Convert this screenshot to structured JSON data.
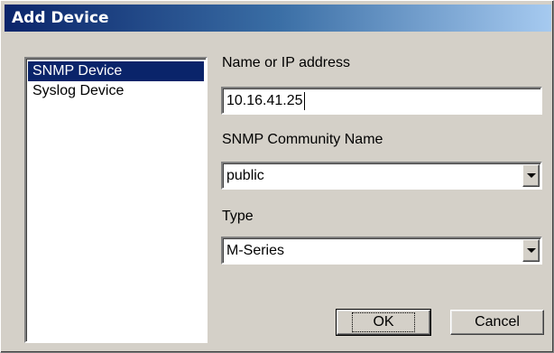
{
  "window": {
    "title": "Add Device"
  },
  "device_list": {
    "items": [
      {
        "label": "SNMP Device",
        "selected": true
      },
      {
        "label": "Syslog Device",
        "selected": false
      }
    ]
  },
  "form": {
    "name_label": "Name or IP address",
    "name_value": "10.16.41.25",
    "community_label": "SNMP Community Name",
    "community_value": "public",
    "type_label": "Type",
    "type_value": "M-Series"
  },
  "buttons": {
    "ok": "OK",
    "cancel": "Cancel"
  },
  "icons": {
    "dropdown": "chevron-down-icon"
  },
  "colors": {
    "title_gradient_start": "#0a246a",
    "title_gradient_end": "#a6caf0",
    "selection": "#0a246a",
    "face": "#d4d0c8"
  }
}
